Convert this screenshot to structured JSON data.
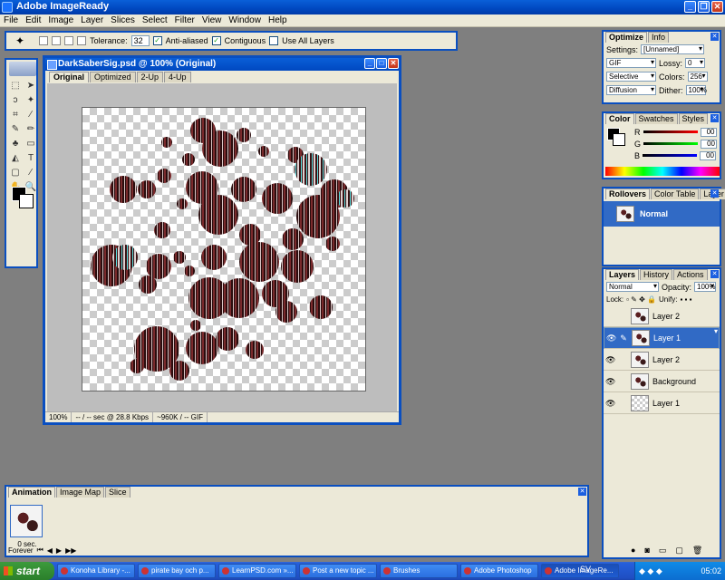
{
  "app": {
    "title": "Adobe ImageReady"
  },
  "menu": [
    "File",
    "Edit",
    "Image",
    "Layer",
    "Slices",
    "Select",
    "Filter",
    "View",
    "Window",
    "Help"
  ],
  "options_bar": {
    "tolerance_label": "Tolerance:",
    "tolerance_value": "32",
    "anti_aliased": "Anti-aliased",
    "contiguous": "Contiguous",
    "use_all_layers": "Use All Layers"
  },
  "document": {
    "title": "DarkSaberSig.psd @ 100% (Original)",
    "tabs": [
      "Original",
      "Optimized",
      "2-Up",
      "4-Up"
    ],
    "active_tab": "Original",
    "status": {
      "zoom": "100%",
      "speed": "-- / -- sec @ 28.8 Kbps",
      "size": "~960K / -- GIF"
    }
  },
  "optimize_panel": {
    "tabs": [
      "Optimize",
      "Info"
    ],
    "settings_label": "Settings:",
    "settings_value": "[Unnamed]",
    "format": "GIF",
    "lossy_label": "Lossy:",
    "lossy_value": "0",
    "reduction": "Selective",
    "colors_label": "Colors:",
    "colors_value": "256",
    "dither_algo": "Diffusion",
    "dither_label": "Dither:",
    "dither_value": "100%"
  },
  "color_panel": {
    "tabs": [
      "Color",
      "Swatches",
      "Styles"
    ],
    "r_label": "R",
    "r_value": "00",
    "g_label": "G",
    "g_value": "00",
    "b_label": "B",
    "b_value": "00"
  },
  "rollovers_panel": {
    "tabs": [
      "Rollovers",
      "Color Table",
      "Layer Options"
    ],
    "state": "Normal"
  },
  "layers_panel": {
    "tabs": [
      "Layers",
      "History",
      "Actions"
    ],
    "blend_mode": "Normal",
    "opacity_label": "Opacity:",
    "opacity_value": "100%",
    "lock_label": "Lock:",
    "unify_label": "Unify:",
    "layers": [
      {
        "name": "Layer 2",
        "visible": false,
        "selected": false
      },
      {
        "name": "Layer 1",
        "visible": true,
        "selected": true
      },
      {
        "name": "Layer 2",
        "visible": true,
        "selected": false
      },
      {
        "name": "Background",
        "visible": true,
        "selected": false
      },
      {
        "name": "Layer 1",
        "visible": true,
        "selected": false
      }
    ]
  },
  "animation_panel": {
    "tabs": [
      "Animation",
      "Image Map",
      "Slice"
    ],
    "frame_delay": "0 sec.",
    "loop": "Forever"
  },
  "taskbar": {
    "start": "start",
    "items": [
      "Konoha Library -...",
      "pirate bay och p...",
      "LearnPSD.com »...",
      "Post a new topic ...",
      "Brushes",
      "Adobe Photoshop",
      "Adobe ImageRe..."
    ],
    "lang": "SV",
    "clock": "05:02"
  }
}
